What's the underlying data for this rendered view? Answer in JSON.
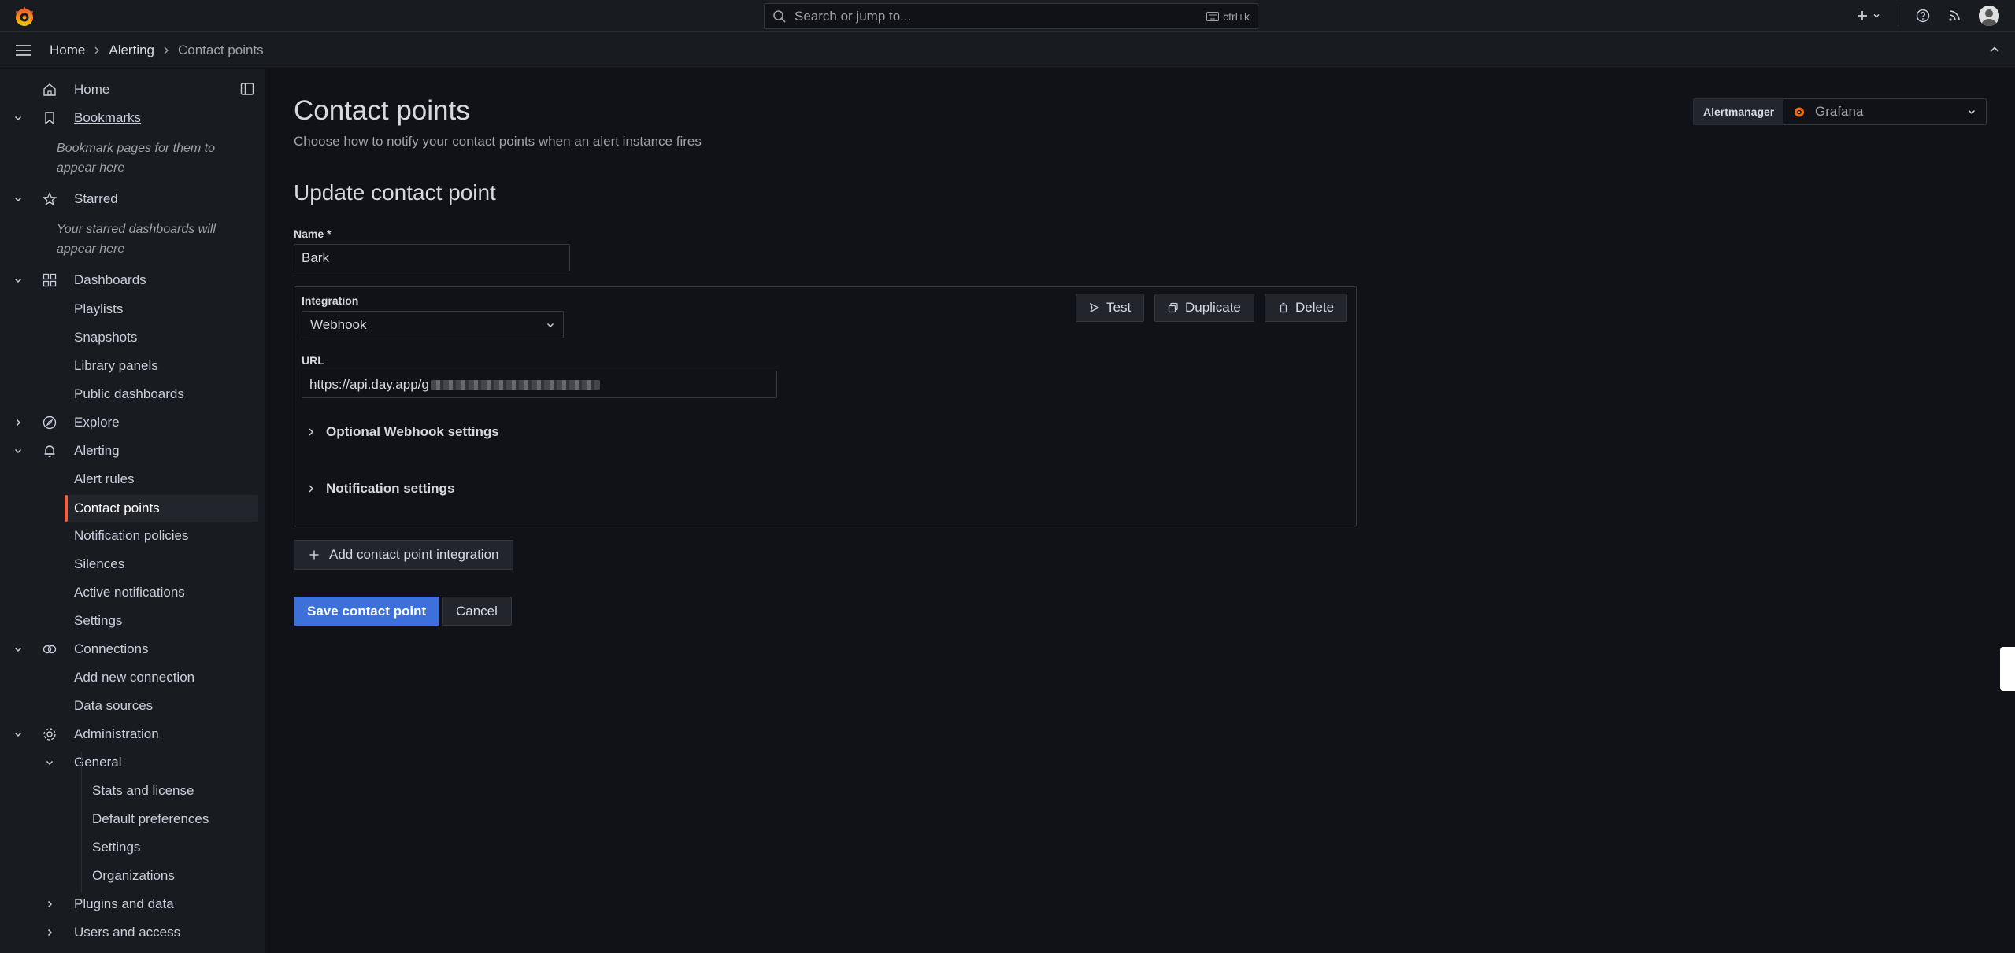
{
  "topbar": {
    "search": {
      "placeholder": "Search or jump to...",
      "shortcut": "ctrl+k"
    }
  },
  "breadcrumb": [
    "Home",
    "Alerting",
    "Contact points"
  ],
  "sidebar": {
    "home": "Home",
    "bookmarks": "Bookmarks",
    "bookmarks_note": "Bookmark pages for them to appear here",
    "starred": "Starred",
    "starred_note": "Your starred dashboards will appear here",
    "dashboards": "Dashboards",
    "dashboards_items": [
      "Playlists",
      "Snapshots",
      "Library panels",
      "Public dashboards"
    ],
    "explore": "Explore",
    "alerting": "Alerting",
    "alerting_items": [
      "Alert rules",
      "Contact points",
      "Notification policies",
      "Silences",
      "Active notifications",
      "Settings"
    ],
    "connections": "Connections",
    "connections_items": [
      "Add new connection",
      "Data sources"
    ],
    "administration": "Administration",
    "general": "General",
    "general_items": [
      "Stats and license",
      "Default preferences",
      "Settings",
      "Organizations"
    ],
    "plugins": "Plugins and data",
    "users": "Users and access"
  },
  "page": {
    "title": "Contact points",
    "subtitle": "Choose how to notify your contact points when an alert instance fires",
    "alertmanager_label": "Alertmanager",
    "alertmanager_value": "Grafana",
    "form_title": "Update contact point"
  },
  "form": {
    "name_label": "Name *",
    "name_value": "Bark",
    "integration_label": "Integration",
    "integration_value": "Webhook",
    "url_label": "URL",
    "url_value": "https://api.day.app/g",
    "test_label": "Test",
    "duplicate_label": "Duplicate",
    "delete_label": "Delete",
    "optional_settings": "Optional Webhook settings",
    "notification_settings": "Notification settings",
    "add_integration": "Add contact point integration",
    "save": "Save contact point",
    "cancel": "Cancel"
  },
  "colors": {
    "accent_orange": "#f55f3e",
    "primary_blue": "#3d71d9",
    "background": "#111217",
    "panel": "#181b1f"
  }
}
